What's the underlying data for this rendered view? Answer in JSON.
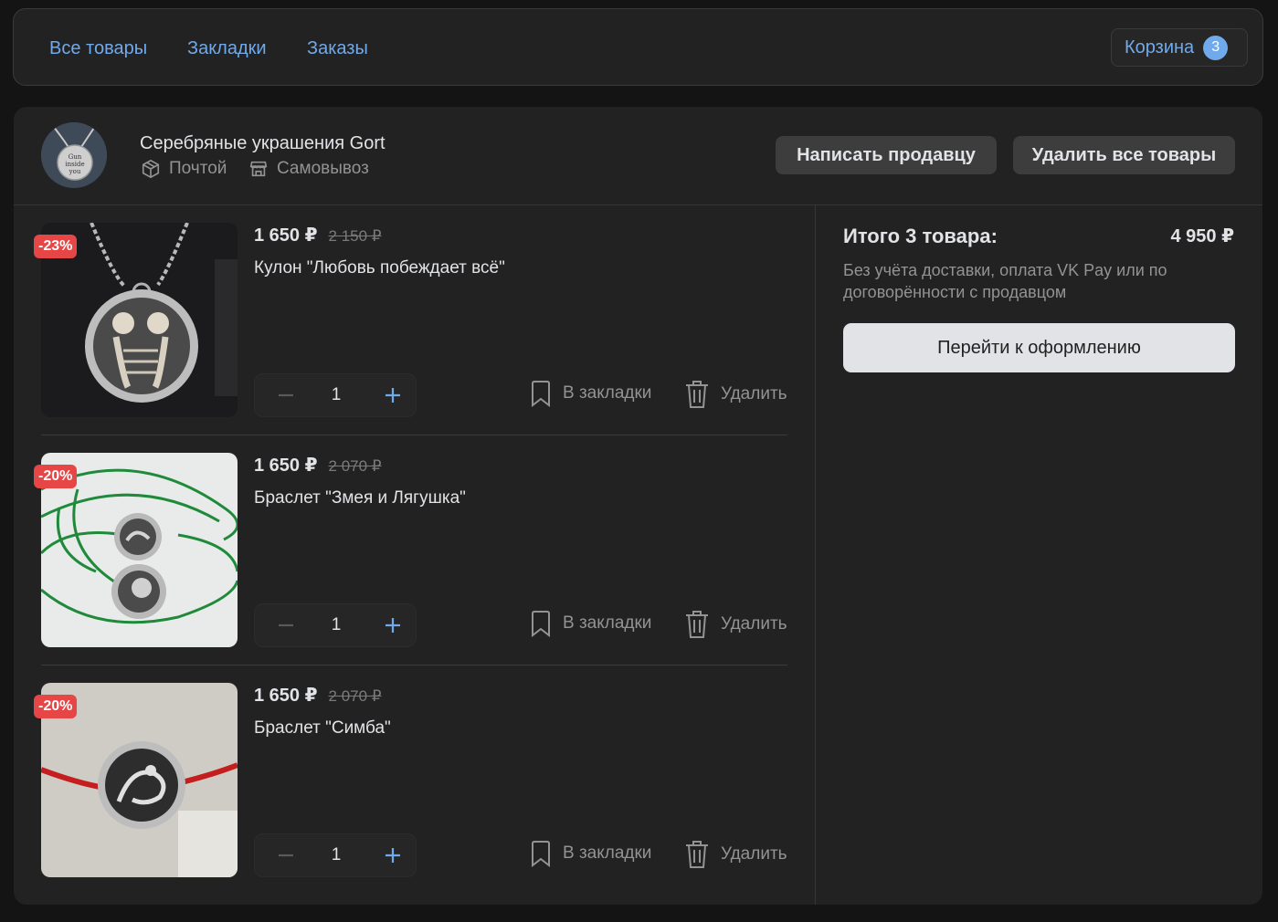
{
  "nav": {
    "links": [
      "Все товары",
      "Закладки",
      "Заказы"
    ],
    "cart_label": "Корзина",
    "cart_count": "3"
  },
  "shop": {
    "name": "Серебряные украшения Gort",
    "delivery_mail": "Почтой",
    "delivery_pickup": "Самовывоз",
    "write_seller": "Написать продавцу",
    "delete_all": "Удалить все товары",
    "avatar_text": [
      "Gun",
      "inside",
      "you"
    ]
  },
  "items": [
    {
      "badge": "-23%",
      "price": "1 650 ₽",
      "old_price": "2 150 ₽",
      "title": "Кулон \"Любовь побеждает всё\"",
      "quantity": "1",
      "bookmark": "В закладки",
      "delete": "Удалить"
    },
    {
      "badge": "-20%",
      "price": "1 650 ₽",
      "old_price": "2 070 ₽",
      "title": "Браслет \"Змея и Лягушка\"",
      "quantity": "1",
      "bookmark": "В закладки",
      "delete": "Удалить"
    },
    {
      "badge": "-20%",
      "price": "1 650 ₽",
      "old_price": "2 070 ₽",
      "title": "Браслет \"Симба\"",
      "quantity": "1",
      "bookmark": "В закладки",
      "delete": "Удалить"
    }
  ],
  "summary": {
    "label": "Итого 3 товара:",
    "total": "4 950 ₽",
    "note": "Без учёта доставки, оплата VK Pay или по договорённости с продавцом",
    "checkout": "Перейти к оформлению"
  },
  "colors": {
    "accent": "#71aaeb",
    "badge": "#e64646",
    "panel": "#222222",
    "background": "#141414"
  }
}
